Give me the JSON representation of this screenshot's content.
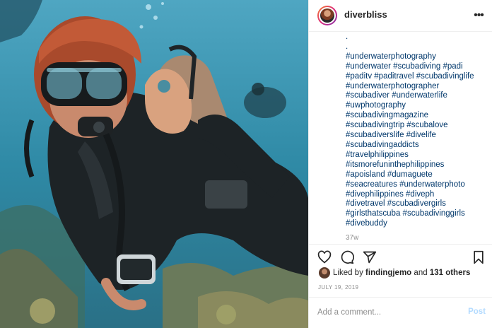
{
  "post": {
    "username": "diverbliss",
    "caption_lines": [
      ".",
      ".",
      "#underwaterphotography",
      "#underwater #scubadiving #padi",
      "#paditv #paditravel #scubadivinglife",
      "#underwaterphotographer",
      "#scubadiver #underwaterlife",
      "#uwphotography",
      "#scubadivingmagazine",
      "#scubadivingtrip #scubalove",
      "#scubadiverslife #divelife",
      "#scubadivingaddicts",
      "#travelphilippines",
      "#itsmorefuninthephilippines",
      "#apoisland #dumaguete",
      "#seacreatures #underwaterphoto",
      "#divephilippines #diveph",
      "#divetravel #scubadivergirls",
      "#girlsthatscuba #scubadivinggirls",
      "#divebuddy"
    ],
    "caption_text": ".\n.\n#underwaterphotography\n#underwater #scubadiving #padi\n#paditv #paditravel #scubadivinglife\n#underwaterphotographer\n#scubadiver #underwaterlife\n#uwphotography\n#scubadivingmagazine\n#scubadivingtrip #scubalove\n#scubadiverslife #divelife\n#scubadivingaddicts\n#travelphilippines\n#itsmorefuninthephilippines\n#apoisland #dumaguete\n#seacreatures #underwaterphoto\n#divephilippines #diveph\n#divetravel #scubadivergirls\n#girlsthatscuba #scubadivinggirls\n#divebuddy",
    "time_ago": "37w",
    "likes": {
      "prefix": "Liked by",
      "user": "findingjemo",
      "joiner": "and",
      "others": "131 others"
    },
    "date": "JULY 19, 2019"
  },
  "comment": {
    "placeholder": "Add a comment...",
    "post_label": "Post"
  },
  "icons": {
    "more": "more-options-icon",
    "like": "heart-icon",
    "comment": "comment-icon",
    "share": "share-icon",
    "save": "bookmark-icon"
  },
  "colors": {
    "hashtag": "#00376b",
    "post_button_disabled": "#b3dbff",
    "text": "#262626",
    "muted": "#8e8e8e"
  }
}
